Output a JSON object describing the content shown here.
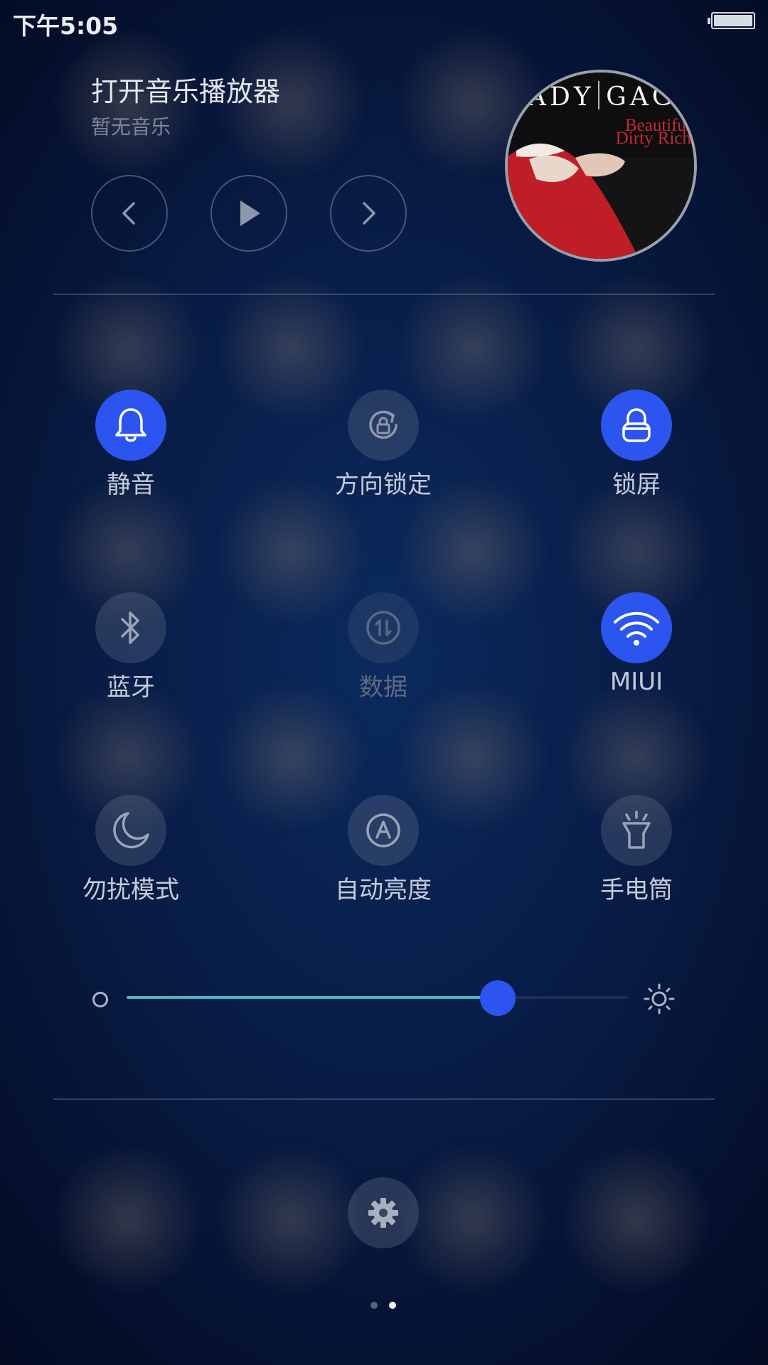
{
  "status_bar": {
    "time": "下午5:05",
    "battery_icon": "battery-full-icon"
  },
  "music": {
    "title": "打开音乐播放器",
    "subtitle": "暂无音乐",
    "controls": [
      "chevron-left-icon",
      "play-icon",
      "chevron-right-icon"
    ],
    "album_artist": "ADY GAG",
    "album_title": "Beautiful Dirty Rich"
  },
  "toggles": [
    {
      "label": "静音",
      "icon": "bell-icon",
      "state": "on"
    },
    {
      "label": "方向锁定",
      "icon": "rotation-lock-icon",
      "state": "off"
    },
    {
      "label": "锁屏",
      "icon": "lock-icon",
      "state": "on"
    },
    {
      "label": "蓝牙",
      "icon": "bluetooth-icon",
      "state": "off"
    },
    {
      "label": "数据",
      "icon": "mobile-data-icon",
      "state": "disabled"
    },
    {
      "label": "MIUI",
      "icon": "wifi-icon",
      "state": "on"
    },
    {
      "label": "勿扰模式",
      "icon": "moon-icon",
      "state": "off"
    },
    {
      "label": "自动亮度",
      "icon": "auto-brightness-icon",
      "state": "off"
    },
    {
      "label": "手电筒",
      "icon": "flashlight-icon",
      "state": "off"
    }
  ],
  "brightness": {
    "level_fraction": 0.74,
    "low_icon": "brightness-low-icon",
    "high_icon": "brightness-high-icon"
  },
  "settings_icon": "gear-icon",
  "page_indicator": {
    "count": 2,
    "active_index": 1
  },
  "colors": {
    "accent": "#2b55ee",
    "slider_fill": "#46b8c4",
    "label": "#c5cbd8",
    "background": "#081c45"
  }
}
